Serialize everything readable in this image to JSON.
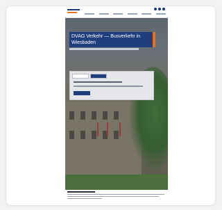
{
  "hero": {
    "title": "DVAG Verkehr — Busverkehr in Wiesbaden"
  },
  "colors": {
    "brand_blue": "#1e3e7e",
    "accent_orange": "#e8731c",
    "page_bg": "#f2f3f5"
  }
}
